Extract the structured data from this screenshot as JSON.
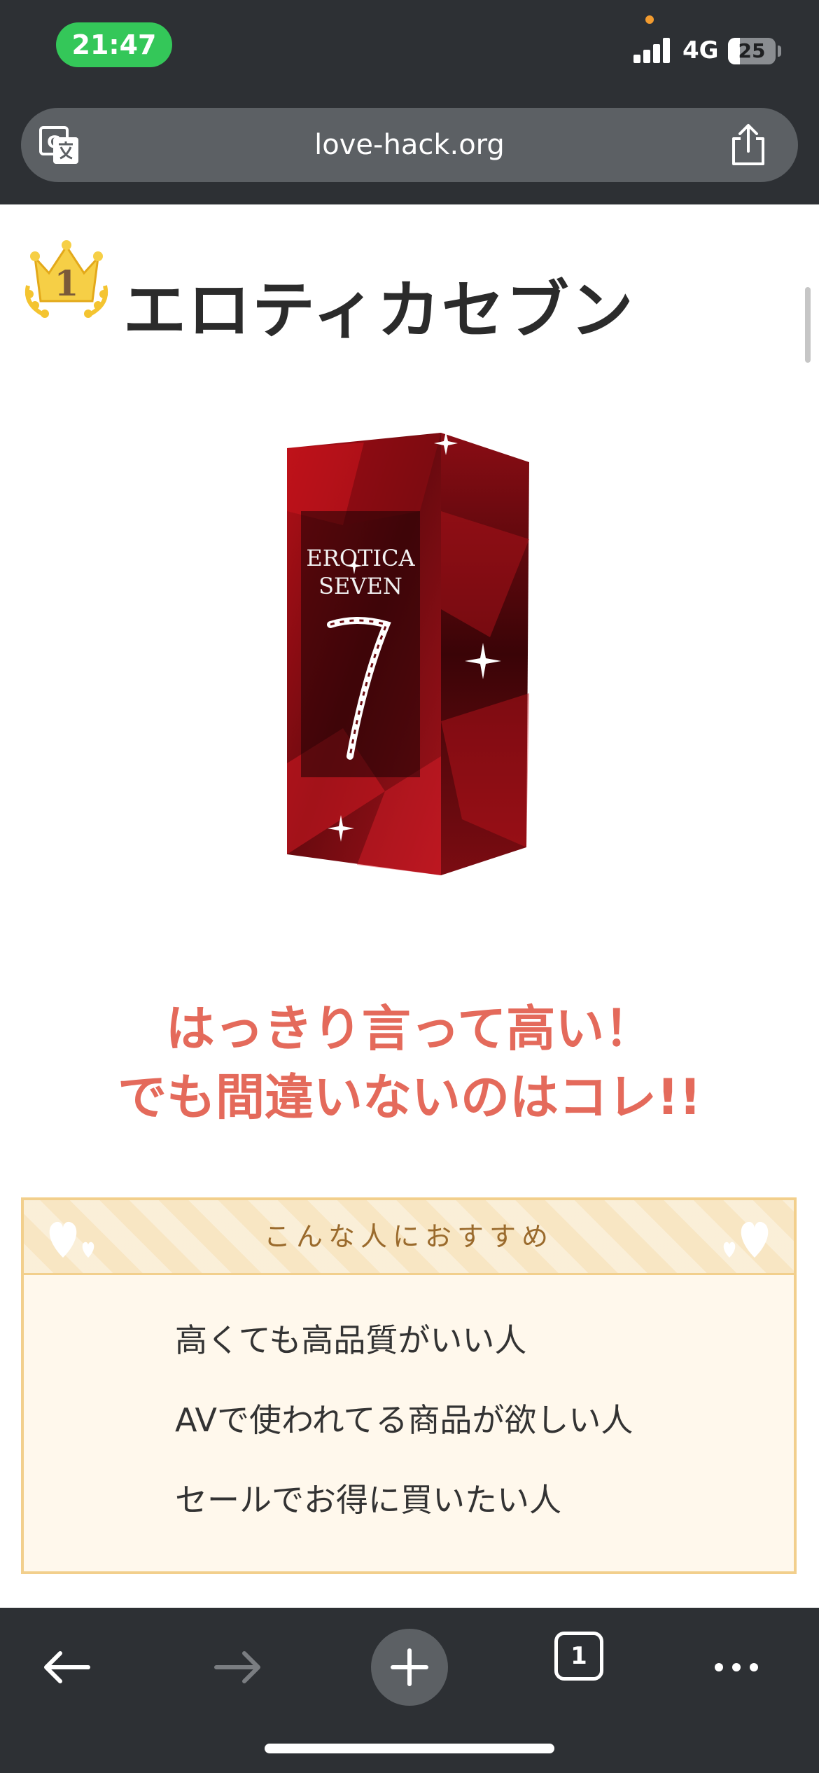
{
  "status_bar": {
    "time": "21:47",
    "network": "4G",
    "battery_level": "25",
    "battery_fraction": 0.25
  },
  "browser": {
    "url": "love-hack.org",
    "tab_count": "1",
    "icons": {
      "translate": "translate-icon",
      "share": "share-icon",
      "back": "back-arrow-icon",
      "forward": "forward-arrow-icon",
      "new_tab": "plus-icon",
      "tabs": "tabs-icon",
      "more": "more-icon"
    }
  },
  "article": {
    "rank": "1",
    "title": "エロティカセブン",
    "product_image_text": [
      "EROTICA",
      "SEVEN"
    ],
    "headline_lines": [
      "はっきり言って高い！",
      "でも間違いないのはコレ!!"
    ],
    "recommend_box": {
      "title": "こんな人におすすめ",
      "items": [
        "高くても高品質がいい人",
        "AVで使われてる商品が欲しい人",
        "セールでお得に買いたい人"
      ]
    }
  },
  "colors": {
    "chrome_bg": "#2d3034",
    "url_pill": "#5c6064",
    "time_pill": "#34c759",
    "headline": "#e46a5b",
    "box_border": "#f2cf8c",
    "box_bg": "#fff8ec"
  }
}
